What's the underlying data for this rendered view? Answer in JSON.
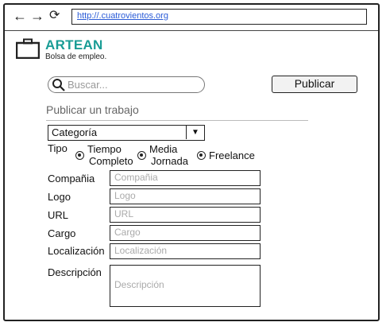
{
  "browser": {
    "url": "http://.cuatrovientos.org"
  },
  "brand": {
    "name": "ARTEAN",
    "subtitle": "Bolsa de empleo."
  },
  "search": {
    "placeholder": "Buscar..."
  },
  "publish_button": "Publicar",
  "section_title": "Publicar un trabajo",
  "category": {
    "value": "Categoría"
  },
  "type": {
    "label": "Tipo",
    "options": [
      {
        "line1": "Tiempo",
        "line2": "Completo"
      },
      {
        "line1": "Media",
        "line2": "Jornada"
      },
      {
        "line1": "Freelance"
      }
    ]
  },
  "form": {
    "fields": [
      {
        "label": "Compañia",
        "placeholder": "Compañia"
      },
      {
        "label": "Logo",
        "placeholder": "Logo"
      },
      {
        "label": "URL",
        "placeholder": "URL"
      },
      {
        "label": "Cargo",
        "placeholder": "Cargo"
      },
      {
        "label": "Localización",
        "placeholder": "Localización"
      }
    ],
    "description": {
      "label": "Descripción",
      "placeholder": "Descripción"
    }
  },
  "colors": {
    "brand": "#199c95",
    "url": "#2a5bd7"
  },
  "icons": [
    "back-arrow-icon",
    "forward-arrow-icon",
    "reload-icon",
    "briefcase-icon",
    "search-icon",
    "dropdown-arrow-icon"
  ]
}
